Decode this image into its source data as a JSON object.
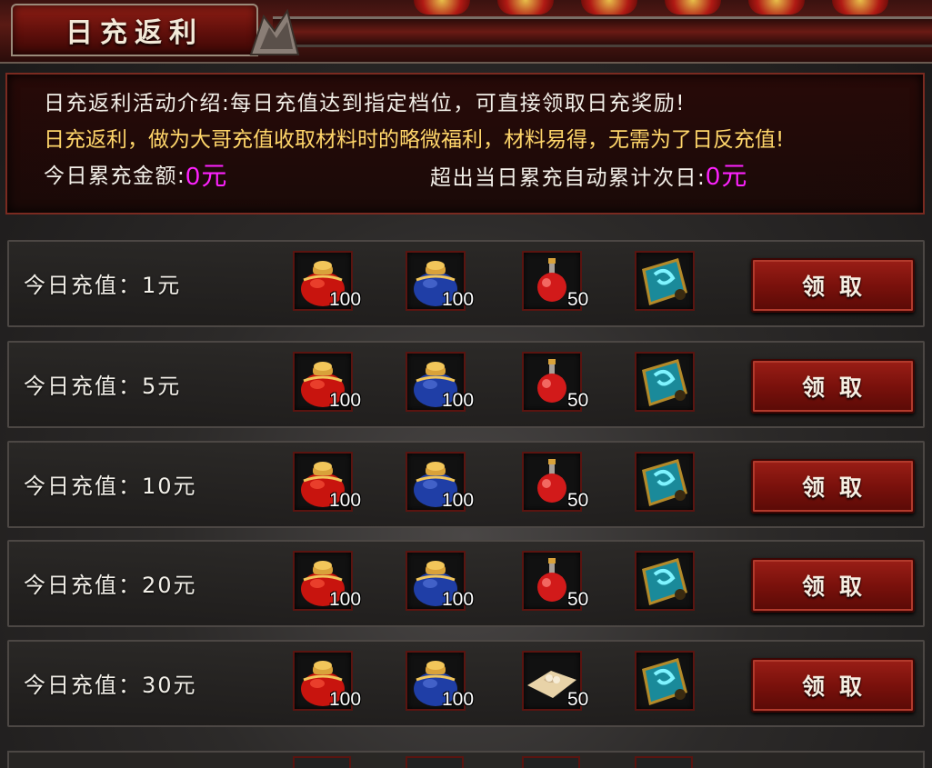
{
  "header": {
    "title": "日充返利"
  },
  "intro": {
    "line1": "日充返利活动介绍:每日充值达到指定档位，可直接领取日充奖励!",
    "line2": "日充返利，做为大哥充值收取材料时的略微福利，材料易得，无需为了日反充值!",
    "today_label": "今日累充金额:",
    "today_value": "0元",
    "carry_label": "超出当日累充自动累计次日:",
    "carry_value": "0元"
  },
  "rows": [
    {
      "label": "今日充值：1元",
      "items": [
        {
          "icon": "red-pouch-icon",
          "qty": "100"
        },
        {
          "icon": "blue-pouch-icon",
          "qty": "100"
        },
        {
          "icon": "red-potion-icon",
          "qty": "50"
        },
        {
          "icon": "scroll-icon",
          "qty": ""
        }
      ],
      "button": "领取"
    },
    {
      "label": "今日充值：5元",
      "items": [
        {
          "icon": "red-pouch-icon",
          "qty": "100"
        },
        {
          "icon": "blue-pouch-icon",
          "qty": "100"
        },
        {
          "icon": "red-potion-icon",
          "qty": "50"
        },
        {
          "icon": "scroll-icon",
          "qty": ""
        }
      ],
      "button": "领取"
    },
    {
      "label": "今日充值：10元",
      "items": [
        {
          "icon": "red-pouch-icon",
          "qty": "100"
        },
        {
          "icon": "blue-pouch-icon",
          "qty": "100"
        },
        {
          "icon": "red-potion-icon",
          "qty": "50"
        },
        {
          "icon": "scroll-icon",
          "qty": ""
        }
      ],
      "button": "领取"
    },
    {
      "label": "今日充值：20元",
      "items": [
        {
          "icon": "red-pouch-icon",
          "qty": "100"
        },
        {
          "icon": "blue-pouch-icon",
          "qty": "100"
        },
        {
          "icon": "red-potion-icon",
          "qty": "50"
        },
        {
          "icon": "scroll-icon",
          "qty": ""
        }
      ],
      "button": "领取"
    },
    {
      "label": "今日充值：30元",
      "items": [
        {
          "icon": "red-pouch-icon",
          "qty": "100"
        },
        {
          "icon": "blue-pouch-icon",
          "qty": "100"
        },
        {
          "icon": "paper-bundle-icon",
          "qty": "50"
        },
        {
          "icon": "scroll-icon",
          "qty": ""
        }
      ],
      "button": "领取"
    }
  ]
}
